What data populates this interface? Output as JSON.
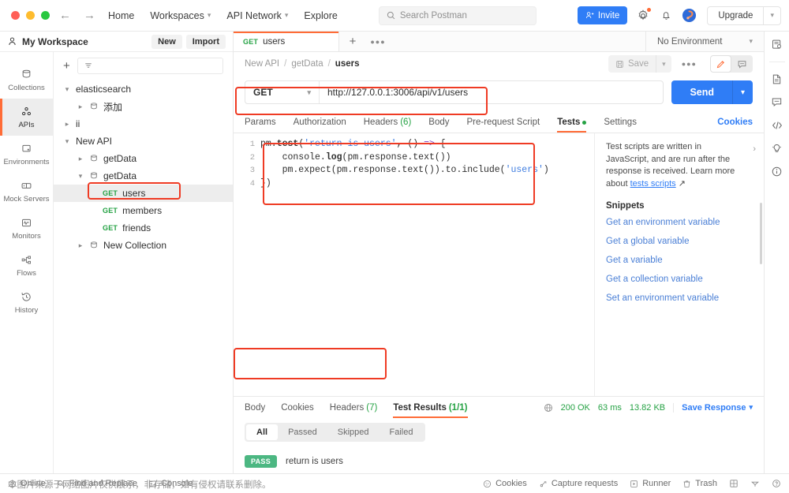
{
  "topbar": {
    "nav": [
      {
        "label": "Home",
        "caret": false
      },
      {
        "label": "Workspaces",
        "caret": true
      },
      {
        "label": "API Network",
        "caret": true
      },
      {
        "label": "Explore",
        "caret": false
      }
    ],
    "search_placeholder": "Search Postman",
    "invite_label": "Invite",
    "upgrade_label": "Upgrade",
    "icons": [
      "search-icon",
      "settings-gear-icon",
      "bell-icon",
      "postman-avatar-icon"
    ]
  },
  "sidebar": {
    "workspace_name": "My Workspace",
    "new_label": "New",
    "import_label": "Import",
    "rail": [
      {
        "label": "Collections",
        "icon": "collections-icon",
        "active": false
      },
      {
        "label": "APIs",
        "icon": "apis-icon",
        "active": true
      },
      {
        "label": "Environments",
        "icon": "environments-icon",
        "active": false
      },
      {
        "label": "Mock Servers",
        "icon": "mock-servers-icon",
        "active": false
      },
      {
        "label": "Monitors",
        "icon": "monitors-icon",
        "active": false
      },
      {
        "label": "Flows",
        "icon": "flows-icon",
        "active": false
      },
      {
        "label": "History",
        "icon": "history-icon",
        "active": false
      }
    ],
    "filter_placeholder": "",
    "tree": [
      {
        "label": "elasticsearch",
        "indent": 0,
        "twisty": "down",
        "folder": false,
        "method": "",
        "selected": false
      },
      {
        "label": "添加",
        "indent": 1,
        "twisty": "right",
        "folder": true,
        "method": "",
        "selected": false
      },
      {
        "label": "ii",
        "indent": 0,
        "twisty": "right",
        "folder": false,
        "method": "",
        "selected": false
      },
      {
        "label": "New API",
        "indent": 0,
        "twisty": "down",
        "folder": false,
        "method": "",
        "selected": false
      },
      {
        "label": "getData",
        "indent": 1,
        "twisty": "right",
        "folder": true,
        "method": "",
        "selected": false
      },
      {
        "label": "getData",
        "indent": 1,
        "twisty": "down",
        "folder": true,
        "method": "",
        "selected": false
      },
      {
        "label": "users",
        "indent": 2,
        "twisty": "",
        "folder": false,
        "method": "GET",
        "selected": true
      },
      {
        "label": "members",
        "indent": 2,
        "twisty": "",
        "folder": false,
        "method": "GET",
        "selected": false
      },
      {
        "label": "friends",
        "indent": 2,
        "twisty": "",
        "folder": false,
        "method": "GET",
        "selected": false
      },
      {
        "label": "New Collection",
        "indent": 1,
        "twisty": "right",
        "folder": true,
        "method": "",
        "selected": false
      }
    ]
  },
  "tabs": {
    "open": [
      {
        "method": "GET",
        "label": "users",
        "active": true
      }
    ],
    "add_icon": "plus-icon",
    "more_icon": "ellipsis-icon",
    "environment_label": "No Environment"
  },
  "breadcrumb": {
    "items": [
      "New API",
      "getData",
      "users"
    ],
    "separator": "/",
    "save_label": "Save",
    "more_icon": "ellipsis-icon",
    "edit_icon": "pencil-icon",
    "comment_icon": "comment-icon"
  },
  "request": {
    "method": "GET",
    "url": "http://127.0.0.1:3006/api/v1/users",
    "send_label": "Send"
  },
  "request_tabs": {
    "items": [
      {
        "label": "Params",
        "count": "",
        "dot": false,
        "active": false
      },
      {
        "label": "Authorization",
        "count": "",
        "dot": false,
        "active": false
      },
      {
        "label": "Headers",
        "count": "(6)",
        "dot": false,
        "active": false
      },
      {
        "label": "Body",
        "count": "",
        "dot": false,
        "active": false
      },
      {
        "label": "Pre-request Script",
        "count": "",
        "dot": false,
        "active": false
      },
      {
        "label": "Tests",
        "count": "",
        "dot": true,
        "active": true
      },
      {
        "label": "Settings",
        "count": "",
        "dot": false,
        "active": false
      }
    ],
    "cookies_label": "Cookies"
  },
  "editor": {
    "line_numbers": [
      "1",
      "2",
      "3",
      "4"
    ],
    "lines": [
      "pm.test('return is users', () => {",
      "    console.log(pm.response.text())",
      "    pm.expect(pm.response.text()).to.include('users')",
      "})"
    ]
  },
  "snippets": {
    "description": "Test scripts are written in JavaScript, and are run after the response is received. Learn more about",
    "doc_link": "tests scripts",
    "title": "Snippets",
    "items": [
      "Get an environment variable",
      "Get a global variable",
      "Get a variable",
      "Get a collection variable",
      "Set an environment variable"
    ]
  },
  "response": {
    "tabs": [
      {
        "label": "Body",
        "count": "",
        "active": false
      },
      {
        "label": "Cookies",
        "count": "",
        "active": false
      },
      {
        "label": "Headers",
        "count": "(7)",
        "active": false
      },
      {
        "label": "Test Results",
        "count": "(1/1)",
        "active": true
      }
    ],
    "status": "200 OK",
    "time": "63 ms",
    "size": "13.82 KB",
    "save_response_label": "Save Response",
    "globe_icon": "globe-icon",
    "filters": [
      {
        "label": "All",
        "active": true
      },
      {
        "label": "Passed",
        "active": false
      },
      {
        "label": "Skipped",
        "active": false
      },
      {
        "label": "Failed",
        "active": false
      }
    ],
    "results": [
      {
        "status": "PASS",
        "name": "return is users"
      }
    ]
  },
  "right_rail": {
    "icons": [
      "environment-quick-look-icon",
      "documentation-icon",
      "comments-icon",
      "code-icon",
      "info-bulb-icon",
      "info-circle-icon"
    ]
  },
  "statusbar": {
    "left": [
      {
        "label": "Online",
        "icon": "online-icon"
      },
      {
        "label": "Find and Replace",
        "icon": "find-replace-icon"
      },
      {
        "label": "Console",
        "icon": "console-icon"
      }
    ],
    "right": [
      {
        "label": "Cookies",
        "icon": "cookies-icon"
      },
      {
        "label": "Capture requests",
        "icon": "capture-icon"
      },
      {
        "label": "Runner",
        "icon": "runner-icon"
      },
      {
        "label": "Trash",
        "icon": "trash-icon"
      },
      {
        "label": "",
        "icon": "layout-icon"
      },
      {
        "label": "",
        "icon": "invite-small-icon"
      },
      {
        "label": "",
        "icon": "help-icon"
      }
    ],
    "watermark": "本图片来源于网络图片仅供展示，非存储，如有侵权请联系删除。"
  },
  "colors": {
    "accent": "#ff6c37",
    "primary": "#2f7df6",
    "success": "#25a244",
    "pass_badge": "#4cb782",
    "annotation": "#ef3b24"
  }
}
